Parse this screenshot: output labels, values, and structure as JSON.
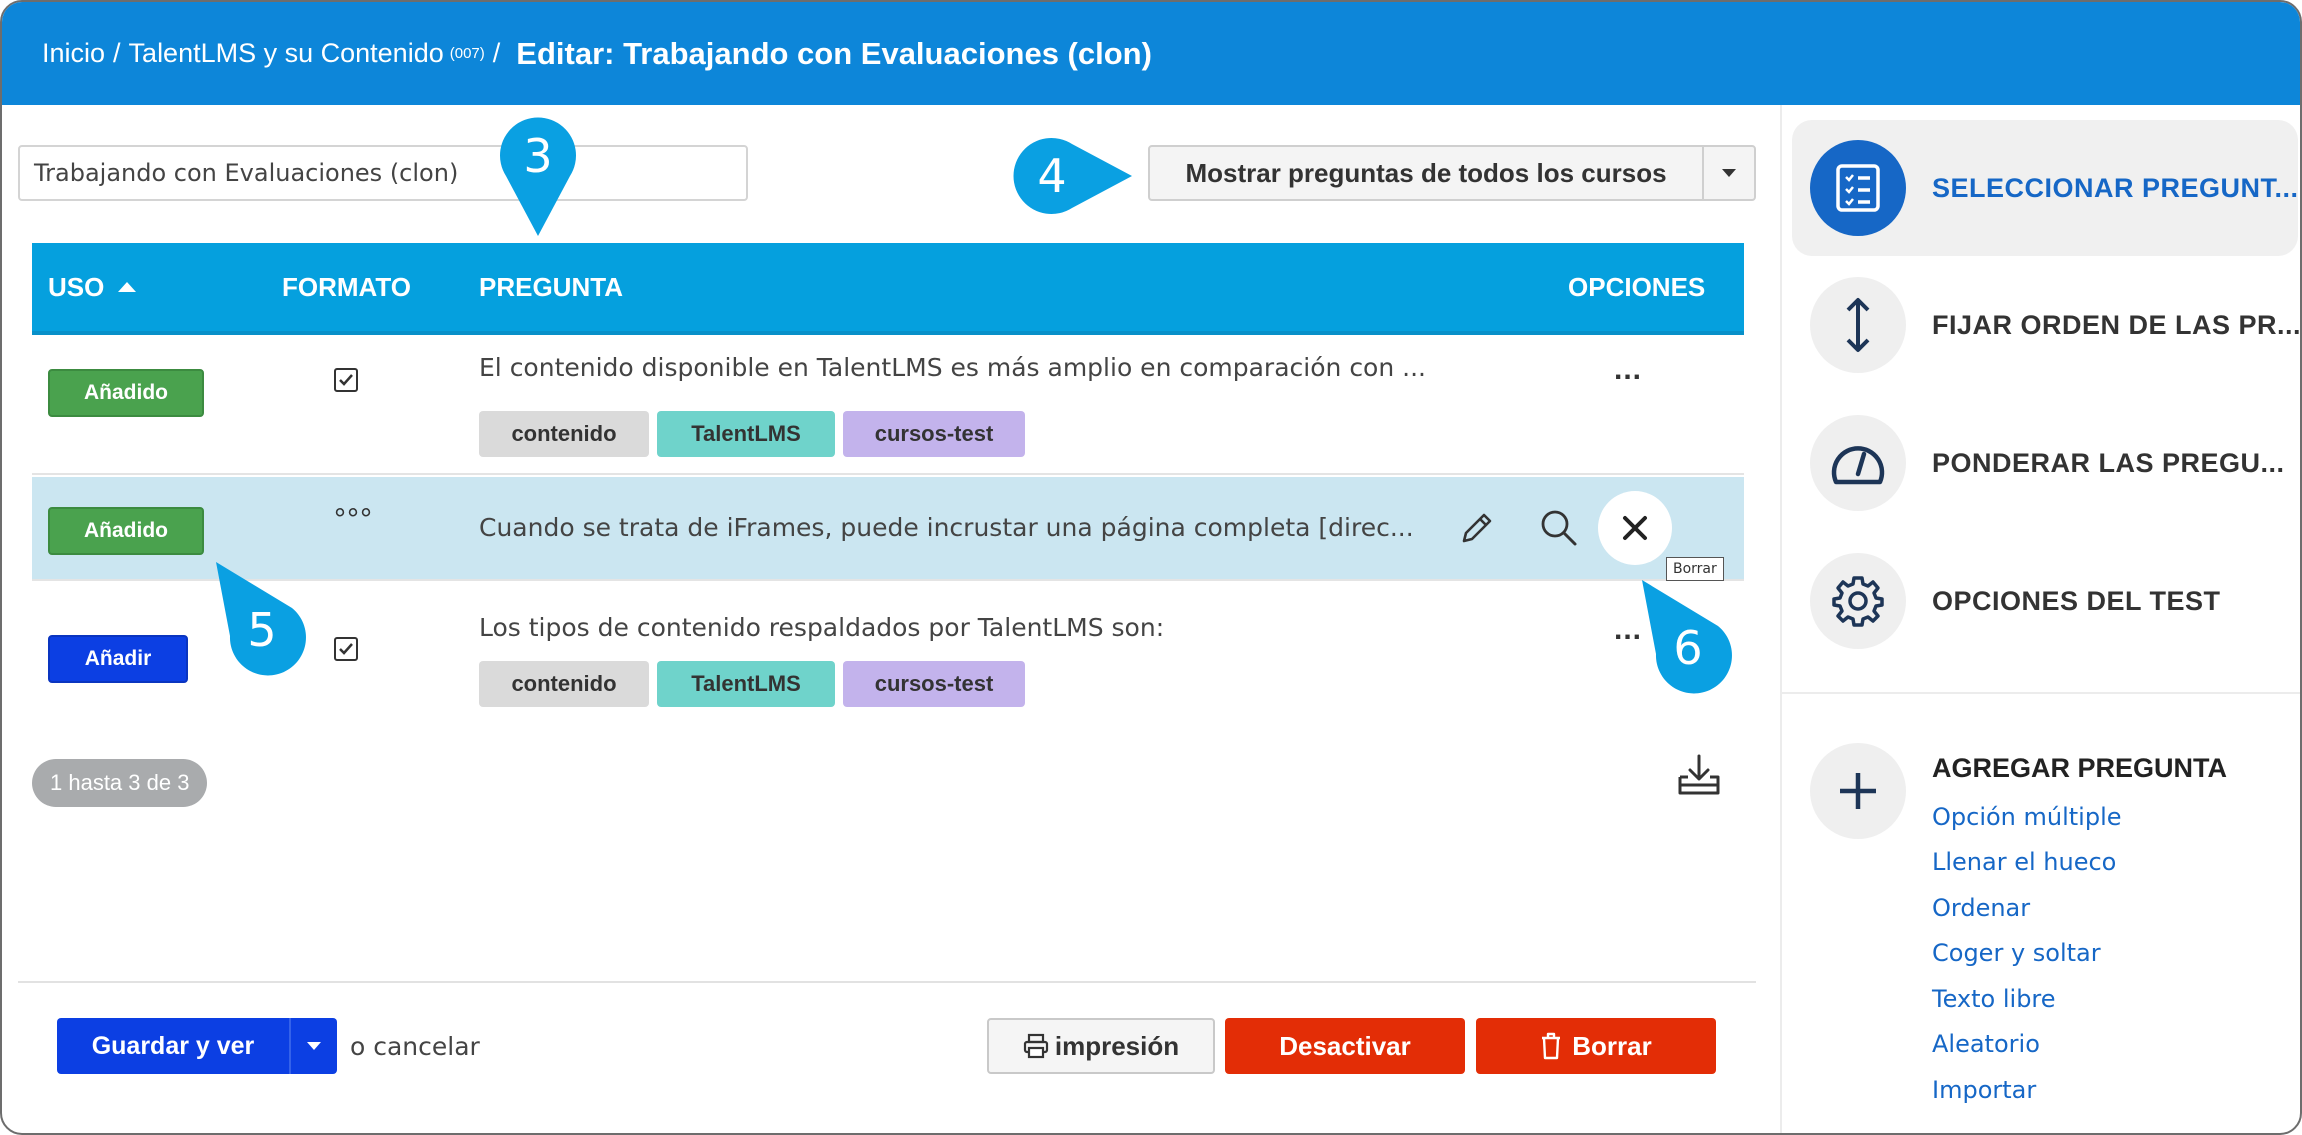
{
  "header": {
    "breadcrumb": [
      {
        "label": "Inicio"
      },
      {
        "label": "TalentLMS y su Contenido",
        "suffix": "(007)"
      }
    ],
    "separator": "/",
    "current": "Editar: Trabajando con Evaluaciones (clon)"
  },
  "test_name_value": "Trabajando con Evaluaciones (clon)",
  "filter": {
    "label": "Mostrar preguntas de todos los cursos"
  },
  "table": {
    "columns": [
      "USO",
      "FORMATO",
      "PREGUNTA",
      "OPCIONES"
    ],
    "rows": [
      {
        "status": "Añadido",
        "format_icon": "checkbox-icon",
        "question": "El contenido disponible en TalentLMS es más amplio en comparación con ...",
        "tags": [
          "contenido",
          "TalentLMS",
          "cursos-test"
        ]
      },
      {
        "status": "Añadido",
        "format_icon": "ordering-dots-icon",
        "format_glyph": "°°°",
        "question": "Cuando se trata de iFrames, puede incrustar una página completa [direc...",
        "tags": [],
        "hover_actions": [
          "pencil-icon",
          "magnifier-icon",
          "close-icon"
        ],
        "tooltip": "Borrar"
      },
      {
        "status": "Añadir",
        "format_icon": "checkbox-icon",
        "question": "Los tipos de contenido respaldados por TalentLMS son:",
        "tags": [
          "contenido",
          "TalentLMS",
          "cursos-test"
        ]
      }
    ],
    "options_glyph": "...",
    "pagination": "1 hasta 3 de 3"
  },
  "footer": {
    "save": "Guardar y ver",
    "cancel": "o cancelar",
    "print": "impresión",
    "deactivate": "Desactivar",
    "delete": "Borrar"
  },
  "sidebar": {
    "items": [
      {
        "label": "SELECCIONAR PREGUNT...",
        "icon": "question-list-icon",
        "active": true
      },
      {
        "label": "FIJAR ORDEN DE LAS PR...",
        "icon": "vertical-arrows-icon"
      },
      {
        "label": "PONDERAR LAS PREGU...",
        "icon": "gauge-icon"
      },
      {
        "label": "OPCIONES DEL TEST",
        "icon": "gear-icon"
      }
    ],
    "add_question": {
      "title": "AGREGAR PREGUNTA",
      "icon": "plus-icon",
      "types": [
        "Opción múltiple",
        "Llenar el hueco",
        "Ordenar",
        "Coger y soltar",
        "Texto libre",
        "Aleatorio",
        "Importar"
      ]
    }
  },
  "annotations": [
    "3",
    "4",
    "5",
    "6"
  ],
  "colors": {
    "header": "#0d86d9",
    "table_header": "#05a0de",
    "added_badge": "#4aa24e",
    "add_badge": "#0c3fe3",
    "danger": "#e32d06",
    "highlight_row": "#cbe6f1",
    "accent": "#1667c6",
    "callout": "#0aa0e2"
  }
}
